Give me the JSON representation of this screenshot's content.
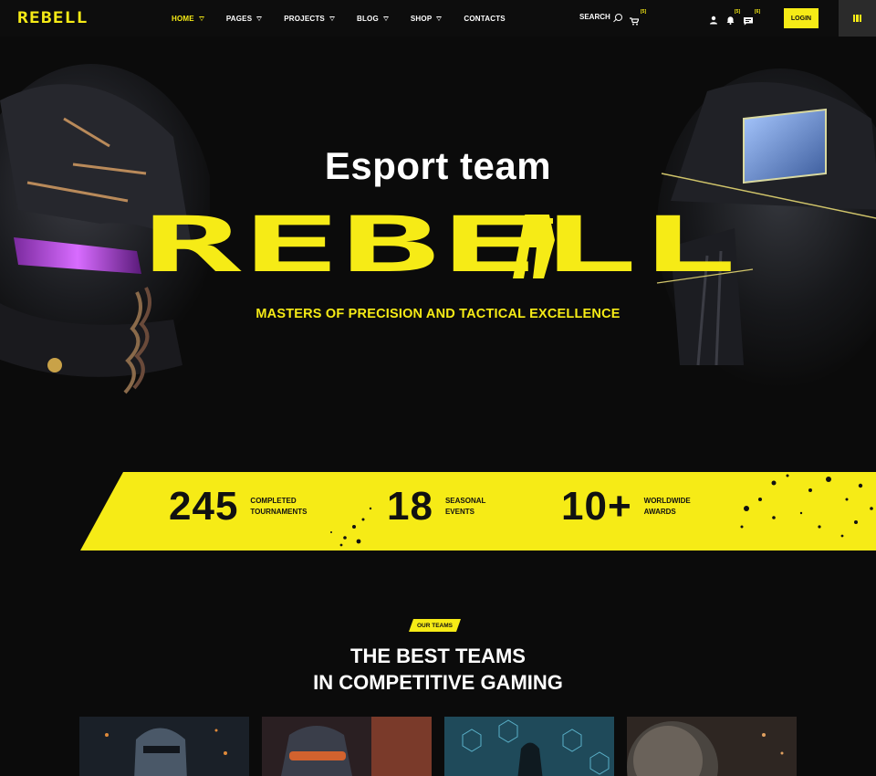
{
  "header": {
    "logo": "REBELL",
    "nav": [
      {
        "label": "HOME",
        "dropdown": true,
        "active": true
      },
      {
        "label": "PAGES",
        "dropdown": true
      },
      {
        "label": "PROJECTS",
        "dropdown": true
      },
      {
        "label": "BLOG",
        "dropdown": true
      },
      {
        "label": "SHOP",
        "dropdown": true
      },
      {
        "label": "CONTACTS",
        "dropdown": false
      }
    ],
    "search_label": "SEARCH",
    "cart_count": "[5]",
    "bell_count": "[5]",
    "chat_count": "[6]",
    "login_label": "LOGIN"
  },
  "hero": {
    "subtitle": "Esport team",
    "title": "REBELL",
    "tagline": "MASTERS OF PRECISION AND TACTICAL EXCELLENCE"
  },
  "stats": [
    {
      "value": "245",
      "label_line1": "COMPLETED",
      "label_line2": "TOURNAMENTS"
    },
    {
      "value": "18",
      "label_line1": "SEASONAL",
      "label_line2": "EVENTS"
    },
    {
      "value": "10+",
      "label_line1": "WORLDWIDE",
      "label_line2": "AWARDS"
    }
  ],
  "teams": {
    "eyebrow": "OUR TEAMS",
    "title_line1": "THE BEST TEAMS",
    "title_line2": "IN COMPETITIVE GAMING"
  },
  "colors": {
    "accent": "#f6eb16",
    "background": "#0b0b0b",
    "dark_text": "#111111"
  }
}
